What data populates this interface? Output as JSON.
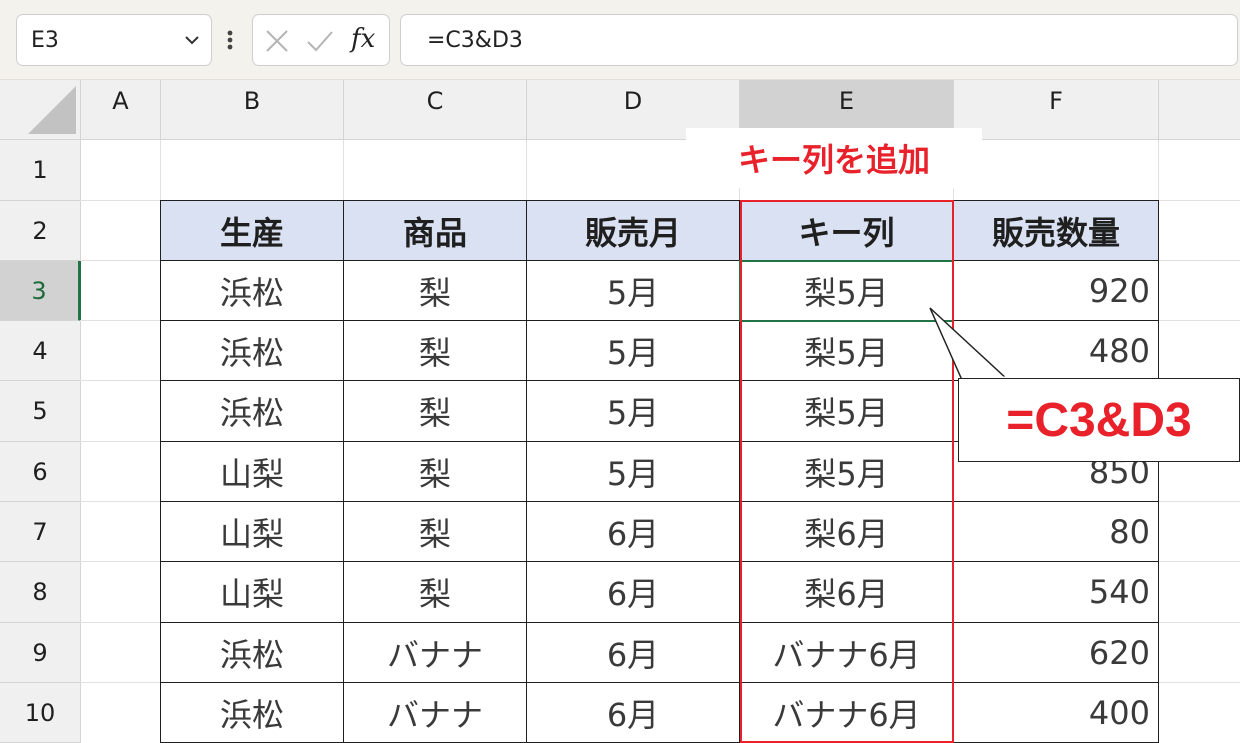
{
  "formula_bar": {
    "name_box": "E3",
    "fx_label": "fx",
    "formula": "=C3&D3"
  },
  "columns": [
    "A",
    "B",
    "C",
    "D",
    "E",
    "F"
  ],
  "selected_column": "E",
  "rows": [
    "1",
    "2",
    "3",
    "4",
    "5",
    "6",
    "7",
    "8",
    "9",
    "10"
  ],
  "selected_row": "3",
  "table": {
    "headers": [
      "生産",
      "商品",
      "販売月",
      "キー列",
      "販売数量"
    ],
    "rows": [
      [
        "浜松",
        "梨",
        "5月",
        "梨5月",
        "920"
      ],
      [
        "浜松",
        "梨",
        "5月",
        "梨5月",
        "480"
      ],
      [
        "浜松",
        "梨",
        "5月",
        "梨5月",
        ""
      ],
      [
        "山梨",
        "梨",
        "5月",
        "梨5月",
        "850"
      ],
      [
        "山梨",
        "梨",
        "6月",
        "梨6月",
        "80"
      ],
      [
        "山梨",
        "梨",
        "6月",
        "梨6月",
        "540"
      ],
      [
        "浜松",
        "バナナ",
        "6月",
        "バナナ6月",
        "620"
      ],
      [
        "浜松",
        "バナナ",
        "6月",
        "バナナ6月",
        "400"
      ]
    ]
  },
  "annotations": {
    "label": "キー列を追加",
    "callout": "=C3&D3"
  },
  "colors": {
    "header_fill": "#d9e1f2",
    "annotation_red": "#e8212a",
    "active_green": "#217346"
  }
}
